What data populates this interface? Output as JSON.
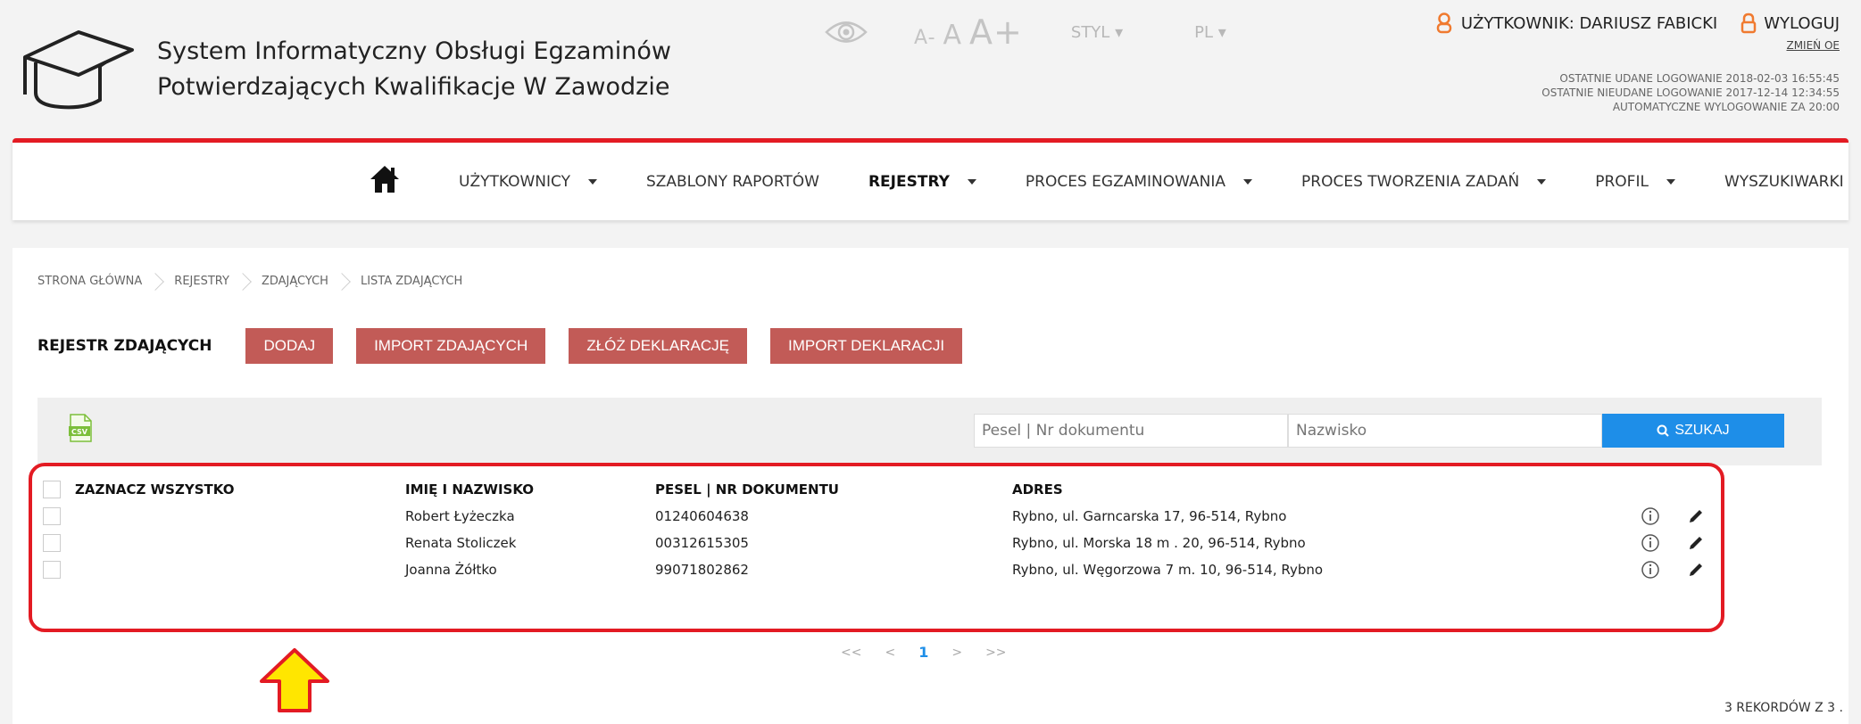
{
  "header": {
    "title_line1": "System Informatyczny Obsługi Egzaminów",
    "title_line2": "Potwierdzających Kwalifikacje W Zawodzie",
    "font_small": "A-",
    "font_mid": "A",
    "font_large": "A+",
    "style_label": "STYL",
    "lang_label": "PL",
    "user_label": "UŻYTKOWNIK: DARIUSZ FABICKI",
    "logout_label": "WYLOGUJ",
    "change_password": "ZMIEŃ OE",
    "last_login": "OSTATNIE UDANE LOGOWANIE 2018-02-03 16:55:45",
    "last_failed": "OSTATNIE NIEUDANE LOGOWANIE 2017-12-14 12:34:55",
    "auto_logout": "AUTOMATYCZNE WYLOGOWANIE ZA  20:00"
  },
  "nav": {
    "items": [
      {
        "label": "UŻYTKOWNICY",
        "dropdown": true
      },
      {
        "label": "SZABLONY RAPORTÓW",
        "dropdown": false
      },
      {
        "label": "REJESTRY",
        "dropdown": true,
        "active": true
      },
      {
        "label": "PROCES EGZAMINOWANIA",
        "dropdown": true
      },
      {
        "label": "PROCES TWORZENIA ZADAŃ",
        "dropdown": true
      },
      {
        "label": "PROFIL",
        "dropdown": true
      },
      {
        "label": "WYSZUKIWARKI",
        "dropdown": true
      }
    ]
  },
  "breadcrumb": [
    "STRONA GŁÓWNA",
    "REJESTRY",
    "ZDAJĄCYCH",
    "LISTA ZDAJĄCYCH"
  ],
  "toolbar": {
    "title": "REJESTR ZDAJĄCYCH",
    "add": "DODAJ",
    "import_candidates": "IMPORT ZDAJĄCYCH",
    "submit_declaration": "ZŁÓŻ DEKLARACJĘ",
    "import_declarations": "IMPORT DEKLARACJI"
  },
  "search": {
    "pesel_placeholder": "Pesel | Nr dokumentu",
    "name_placeholder": "Nazwisko",
    "button": "SZUKAJ",
    "csv_label": "CSV"
  },
  "table": {
    "headers": {
      "select_all": "ZAZNACZ WSZYSTKO",
      "name": "IMIĘ I NAZWISKO",
      "pesel": "PESEL | NR DOKUMENTU",
      "address": "ADRES"
    },
    "rows": [
      {
        "name": "Robert Łyżeczka",
        "pesel": "01240604638",
        "address": "Rybno, ul. Garncarska 17, 96-514, Rybno"
      },
      {
        "name": "Renata Stoliczek",
        "pesel": "00312615305",
        "address": "Rybno, ul. Morska 18 m . 20, 96-514, Rybno"
      },
      {
        "name": "Joanna Żółtko",
        "pesel": "99071802862",
        "address": "Rybno, ul. Węgorzowa 7 m. 10, 96-514, Rybno"
      }
    ]
  },
  "pager": {
    "first": "<<",
    "prev": "<",
    "current": "1",
    "next": ">",
    "last": ">>"
  },
  "records": "3   REKORDÓW Z   3   .",
  "colors": {
    "accent_red": "#e31b23",
    "button_red": "#c25b57",
    "search_blue": "#1e8ee8",
    "arrow_yellow": "#ffe600"
  }
}
